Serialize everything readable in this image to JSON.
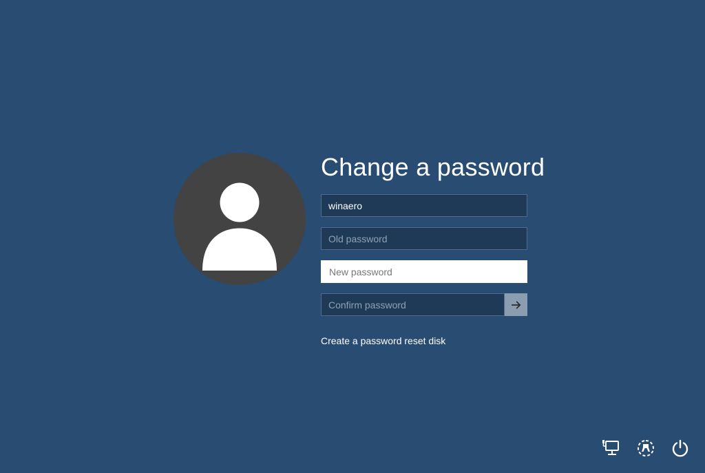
{
  "title": "Change a password",
  "username": {
    "value": "winaero"
  },
  "oldPassword": {
    "placeholder": "Old password",
    "value": ""
  },
  "newPassword": {
    "placeholder": "New password",
    "value": ""
  },
  "confirmPassword": {
    "placeholder": "Confirm password",
    "value": ""
  },
  "link": "Create a password reset disk",
  "icons": {
    "network": "network-icon",
    "ease": "ease-of-access-icon",
    "power": "power-icon"
  }
}
